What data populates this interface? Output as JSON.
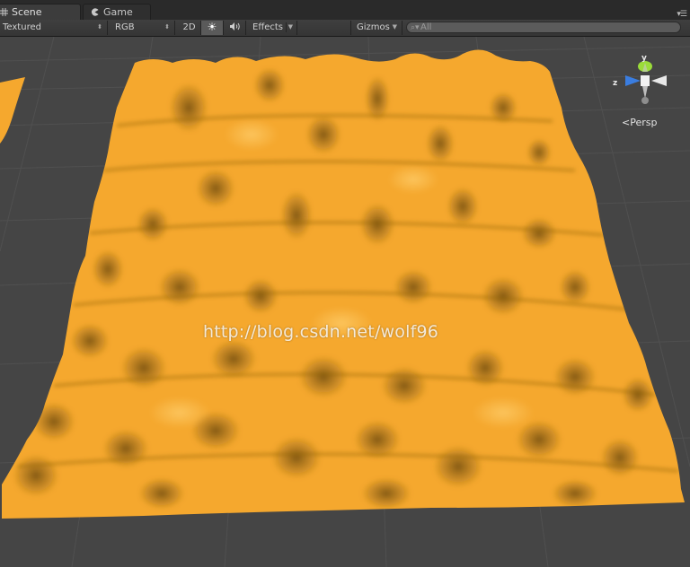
{
  "tabs": [
    {
      "label": "Scene",
      "icon": "scene-grid-icon",
      "active": true
    },
    {
      "label": "Game",
      "icon": "game-pacman-icon",
      "active": false
    }
  ],
  "panel_menu_icon": "panel-menu-icon",
  "toolbar": {
    "render_mode": "Textured",
    "color_mode": "RGB",
    "view_2d_label": "2D",
    "lighting_icon": "sun-icon",
    "audio_icon": "speaker-icon",
    "effects_label": "Effects",
    "gizmos_label": "Gizmos",
    "search_placeholder": "All"
  },
  "viewport": {
    "watermark": "http://blog.csdn.net/wolf96",
    "projection_label": "Persp",
    "axis_labels": {
      "y": "y",
      "z": "z"
    },
    "colors": {
      "background": "#454545",
      "grid": "#4e4e4e",
      "terrain": "#f5a82e",
      "terrain_shadow": "#7a5310",
      "gizmo_y": "#9bdc3a",
      "gizmo_z": "#3a7de0"
    }
  }
}
